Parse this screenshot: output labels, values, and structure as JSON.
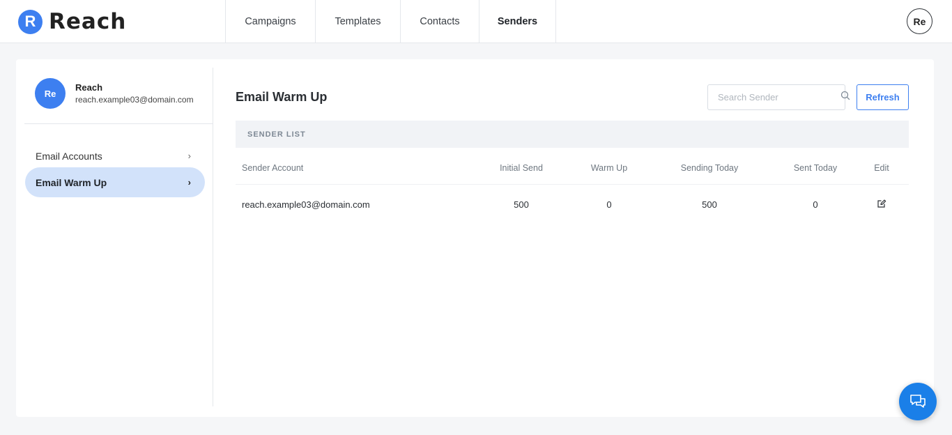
{
  "app": {
    "logo_letter": "R",
    "name": "Reach",
    "user_initials": "Re"
  },
  "nav": {
    "items": [
      {
        "label": "Campaigns",
        "active": false
      },
      {
        "label": "Templates",
        "active": false
      },
      {
        "label": "Contacts",
        "active": false
      },
      {
        "label": "Senders",
        "active": true
      }
    ]
  },
  "sidebar": {
    "profile": {
      "initials": "Re",
      "name": "Reach",
      "email": "reach.example03@domain.com"
    },
    "items": [
      {
        "label": "Email Accounts",
        "active": false
      },
      {
        "label": "Email Warm Up",
        "active": true
      }
    ]
  },
  "main": {
    "title": "Email Warm Up",
    "search_placeholder": "Search Sender",
    "refresh_label": "Refresh",
    "list_header": "SENDER LIST",
    "columns": [
      "Sender Account",
      "Initial Send",
      "Warm Up",
      "Sending Today",
      "Sent Today",
      "Edit"
    ],
    "rows": [
      {
        "account": "reach.example03@domain.com",
        "initial_send": "500",
        "warm_up": "0",
        "sending_today": "500",
        "sent_today": "0"
      }
    ]
  },
  "colors": {
    "accent": "#3d7ff0",
    "active_bg": "#d2e2fa",
    "chat_button": "#1a7fe8"
  }
}
